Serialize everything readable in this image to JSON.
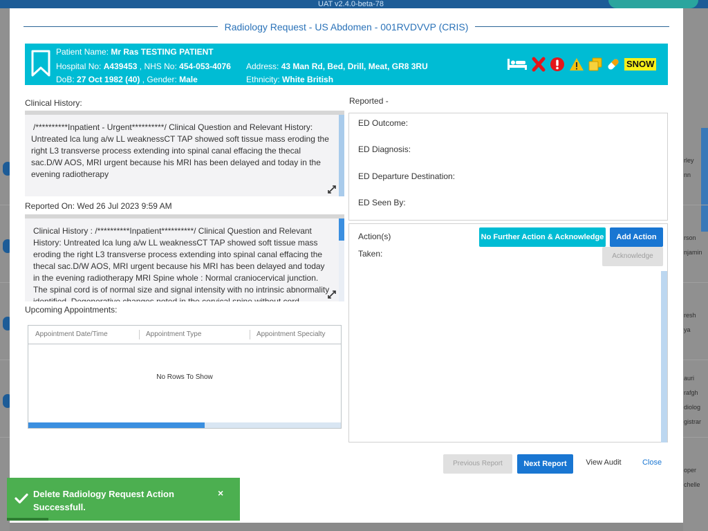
{
  "background": {
    "topbar_text": "UAT v2.4.0-beta-78",
    "right_names": [
      "rley",
      "nn",
      "rson",
      "njamin",
      "resh",
      "ya",
      "auri",
      "rafgh",
      "diolog",
      "gistrar",
      "oper",
      "chelle"
    ]
  },
  "modal": {
    "title": "Radiology Request - US Abdomen - 001RVDVVP (CRIS)"
  },
  "patient": {
    "name_label": "Patient Name:",
    "name": "Mr Ras TESTING PATIENT",
    "hospital_label": "Hospital No:",
    "hospital_no": "A439453",
    "nhs_label": ", NHS No:",
    "nhs_no": "454-053-4076",
    "address_label": "Address:",
    "address": "43 Man Rd, Bed, Drill, Meat, GR8 3RU",
    "dob_label": "DoB:",
    "dob": "27 Oct 1982 (40)",
    "gender_label": ", Gender:",
    "gender": "Male",
    "ethnicity_label": "Ethnicity:",
    "ethnicity": "White British",
    "alert_tag": "SNOW",
    "icons": [
      "bed-icon",
      "cross-icon",
      "alert-circle-icon",
      "warning-icon",
      "copy-icon",
      "pill-icon"
    ]
  },
  "clinical_history": {
    "label": "Clinical History:",
    "text": "/**********Inpatient - Urgent**********/ Clinical Question and Relevant History: Untreated lca lung a/w LL weaknessCT TAP showed soft tissue mass eroding the right L3 transverse process extending into spinal canal effacing the thecal sac.D/W AOS, MRI urgent because his MRI has been delayed and today in the evening radiotherapy"
  },
  "reported_on": {
    "label": "Reported On:",
    "value": "Wed 26 Jul 2023 9:59 AM",
    "text": "Clinical History : /**********Inpatient**********/ Clinical Question and Relevant History: Untreated lca lung a/w LL weaknessCT TAP showed soft tissue mass eroding the right L3 transverse process extending into spinal canal effacing the thecal sac.D/W AOS, MRI urgent because his MRI has been delayed and today in the evening radiotherapy  MRI Spine whole : Normal craniocervical junction. The spinal cord is of normal size and signal intensity with no intrinsic abnormality identified. Degenerative changes noted in the cervical spine without cord"
  },
  "appointments": {
    "label": "Upcoming Appointments:",
    "columns": [
      "Appointment Date/Time",
      "Appointment Type",
      "Appointment Specialty"
    ],
    "empty_text": "No Rows To Show"
  },
  "reported": {
    "label": "Reported -",
    "fields": [
      "ED Outcome:",
      "ED Diagnosis:",
      "ED Departure Destination:",
      "ED Seen By:"
    ]
  },
  "actions": {
    "label": "Action(s)",
    "taken_label": "Taken:",
    "no_further_action": "No Further Action & Acknowledge",
    "add_action": "Add Action",
    "acknowledge": "Acknowledge"
  },
  "footer": {
    "previous": "Previous Report",
    "next": "Next Report",
    "audit": "View Audit",
    "close": "Close"
  },
  "toast": {
    "message": "Delete Radiology Request Action Successfull.",
    "close": "×"
  }
}
